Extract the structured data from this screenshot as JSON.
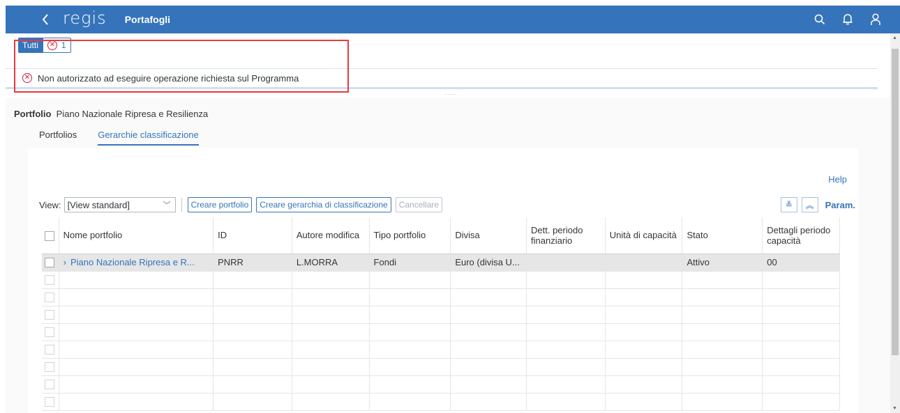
{
  "header": {
    "logo": "regis",
    "title": "Portafogli"
  },
  "messages": {
    "tab_all": "Tutti",
    "error_count": "1",
    "error_text": "Non autorizzato ad eseguire operazione richiesta sul Programma"
  },
  "portfolio": {
    "label": "Portfolio",
    "value": "Piano Nazionale Ripresa e Resilienza"
  },
  "tabs": [
    {
      "label": "Portfolios"
    },
    {
      "label": "Gerarchie classificazione"
    }
  ],
  "panel": {
    "help": "Help",
    "view_label": "View:",
    "view_value": "[View standard]",
    "btn_create_portfolio": "Creare portfolio",
    "btn_create_hierarchy": "Creare gerarchia di classificazione",
    "btn_delete": "Cancellare",
    "param": "Param."
  },
  "table": {
    "columns": [
      "Nome portfolio",
      "ID",
      "Autore modifica",
      "Tipo portfolio",
      "Divisa",
      "Dett. periodo finanziario",
      "Unità di capacità",
      "Stato",
      "Dettagli periodo capacità"
    ],
    "rows": [
      [
        "Piano Nazionale Ripresa e R...",
        "PNRR",
        "L.MORRA",
        "Fondi",
        "Euro (divisa U...",
        "",
        "",
        "Attivo",
        "00"
      ]
    ]
  },
  "colors": {
    "header_bg": "#3574ba",
    "error": "#d32030",
    "highlight": "#e8393f"
  }
}
